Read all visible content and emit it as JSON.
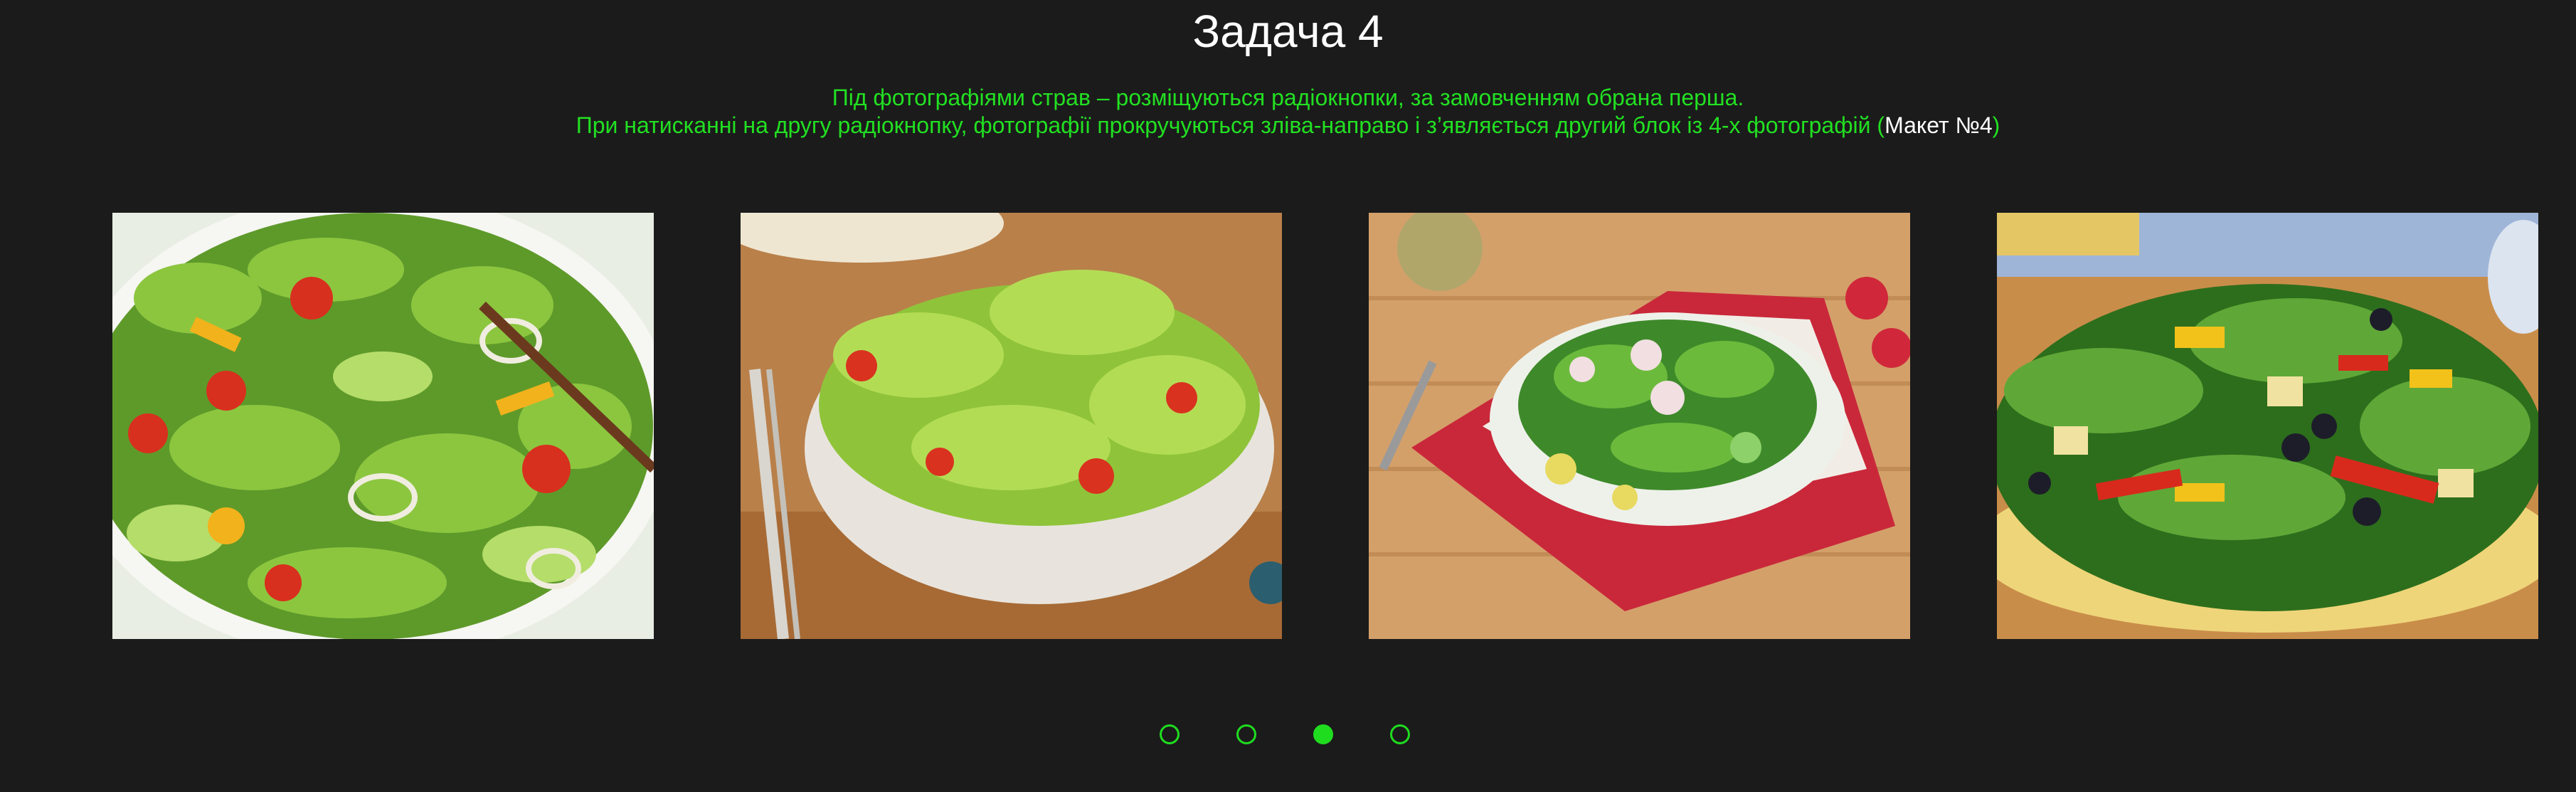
{
  "page": {
    "title": "Задача 4",
    "description_line1": "Під фотографіями страв – розміщуються радіокнопки, за замовченням обрана перша.",
    "description_line2_prefix": "При натисканні на другу радіокнопку, фотографії прокручуються зліва-направо і з’являється другий блок із 4-х фотографій (",
    "description_line2_link": "Макет №4",
    "description_line2_suffix": ")"
  },
  "colors": {
    "background": "#1b1b1b",
    "accent_green": "#1fdc1f",
    "title_white": "#ffffff"
  },
  "gallery": {
    "photos": [
      {
        "subject": "salad-bowl-white-plate-with-fork"
      },
      {
        "subject": "lettuce-salad-in-white-bowl"
      },
      {
        "subject": "green-salad-on-plate-with-red-napkin"
      },
      {
        "subject": "salad-with-peppers-in-yellow-bowl"
      }
    ]
  },
  "radios": {
    "count": 4,
    "selected_index": 3
  }
}
